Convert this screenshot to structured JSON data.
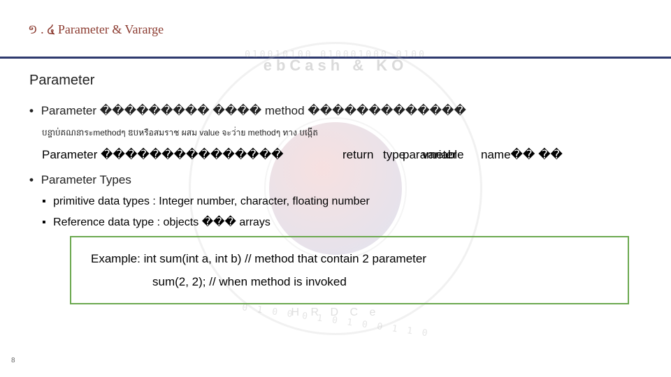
{
  "header": {
    "title": "១ . ໔ Parameter & Vararge"
  },
  "section": {
    "title": "Parameter",
    "bullet1_prefix": "Parameter ",
    "bullet1_boxes": "���������",
    "bullet1_boxes2": " ���� ",
    "bullet1_method": "method ",
    "bullet1_boxes3": "�������������",
    "khmer_line": "បន្ទាប់គណនាระmethodๆ ឌបหรือสมราช ผสม value จะว่่าย methodๆ ทาง បង្កើត",
    "overlap_base": "Parameter ���������������",
    "overlap_return": "return",
    "overlap_type": "type",
    "overlap_param": "parameter",
    "overlap_variable": "variable",
    "overlap_name": "name�� ��",
    "bullet2": "Parameter Types",
    "sub1": "primitive data types : Integer number, character, floating number",
    "sub2_a": "Reference data type : objects ",
    "sub2_boxes": "��� ",
    "sub2_b": "arrays",
    "example_line1": "Example: int sum(int a, int b)  // method that contain 2 parameter",
    "example_line2": "sum(2, 2);  // when method is invoked"
  },
  "page": {
    "marker": "8"
  }
}
